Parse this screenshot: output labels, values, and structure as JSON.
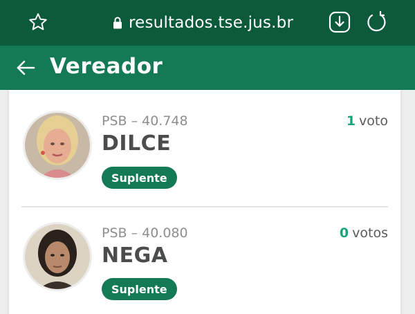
{
  "browser": {
    "url": "resultados.tse.jus.br",
    "icons": [
      "star-icon",
      "lock-icon",
      "download-icon",
      "reload-icon"
    ]
  },
  "header": {
    "title": "Vereador",
    "back_icon": "arrow-left-icon"
  },
  "colors": {
    "browser_bar": "#0c5a3a",
    "header": "#137a55",
    "badge": "#137a55",
    "vote_count": "#19a57a"
  },
  "candidates": [
    {
      "party_number": "PSB – 40.748",
      "name": "DILCE",
      "status": "Suplente",
      "vote_count": "1",
      "vote_label": "voto"
    },
    {
      "party_number": "PSB – 40.080",
      "name": "NEGA",
      "status": "Suplente",
      "vote_count": "0",
      "vote_label": "votos"
    }
  ]
}
